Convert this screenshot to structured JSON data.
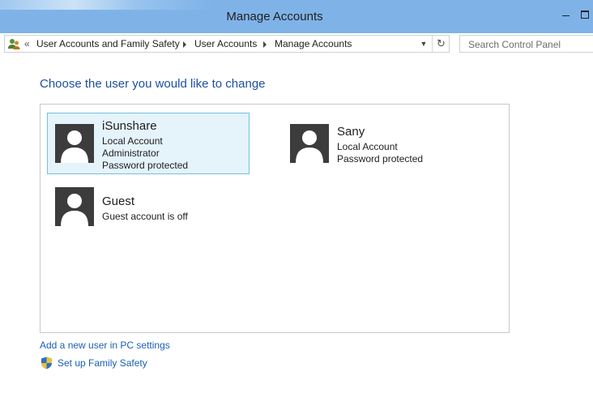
{
  "window": {
    "title": "Manage Accounts"
  },
  "addressbar": {
    "back_glyph": "«",
    "breadcrumbs": [
      {
        "label": "User Accounts and Family Safety"
      },
      {
        "label": "User Accounts"
      },
      {
        "label": "Manage Accounts"
      }
    ],
    "dropdown_glyph": "▼",
    "refresh_glyph": "↻"
  },
  "search": {
    "placeholder": "Search Control Panel"
  },
  "main": {
    "heading": "Choose the user you would like to change",
    "accounts": [
      {
        "name": "iSunshare",
        "details": [
          "Local Account",
          "Administrator",
          "Password protected"
        ],
        "selected": true
      },
      {
        "name": "Sany",
        "details": [
          "Local Account",
          "Password protected"
        ],
        "selected": false
      },
      {
        "name": "Guest",
        "details": [
          "Guest account is off"
        ],
        "selected": false
      }
    ]
  },
  "links": {
    "add_user": "Add a new user in PC settings",
    "family_safety": "Set up Family Safety"
  },
  "colors": {
    "titlebar": "#7fb3e8",
    "heading": "#1e4f9e",
    "link": "#1a5fb4",
    "selected_tile_bg": "#e5f3fb",
    "selected_tile_border": "#70c0e7",
    "avatar_bg": "#3c3c3c"
  },
  "icons": {
    "control_panel": "users-control-panel-icon",
    "avatar": "user-silhouette-icon",
    "shield": "uac-shield-icon"
  }
}
